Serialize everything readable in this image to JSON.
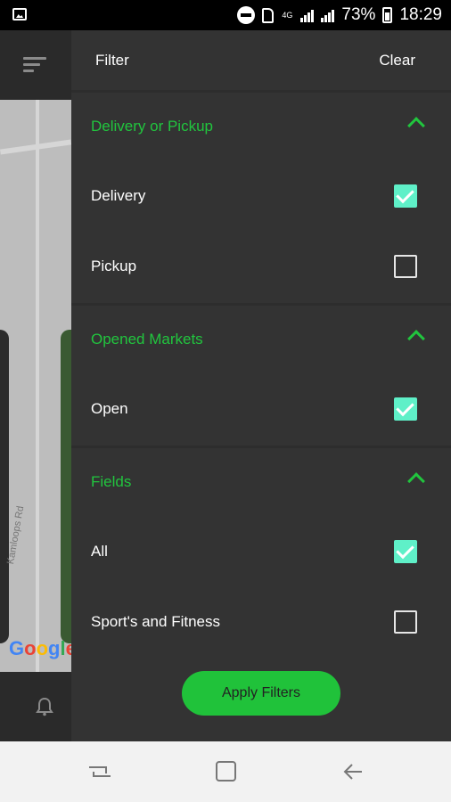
{
  "status_bar": {
    "battery": "73%",
    "time": "18:29",
    "network": "4G"
  },
  "background_app": {
    "map_road_label": "Kamloops Rd",
    "map_logo": "Google"
  },
  "drawer": {
    "title": "Filter",
    "clear_label": "Clear",
    "sections": [
      {
        "title": "Delivery or Pickup",
        "options": [
          {
            "label": "Delivery",
            "checked": true
          },
          {
            "label": "Pickup",
            "checked": false
          }
        ]
      },
      {
        "title": "Opened Markets",
        "options": [
          {
            "label": "Open",
            "checked": true
          }
        ]
      },
      {
        "title": "Fields",
        "options": [
          {
            "label": "All",
            "checked": true
          },
          {
            "label": "Sport's and Fitness",
            "checked": false
          }
        ]
      }
    ],
    "apply_label": "Apply Filters"
  },
  "colors": {
    "accent": "#21c53e",
    "checkbox_checked": "#5ff0c8",
    "drawer_bg": "#333333"
  }
}
